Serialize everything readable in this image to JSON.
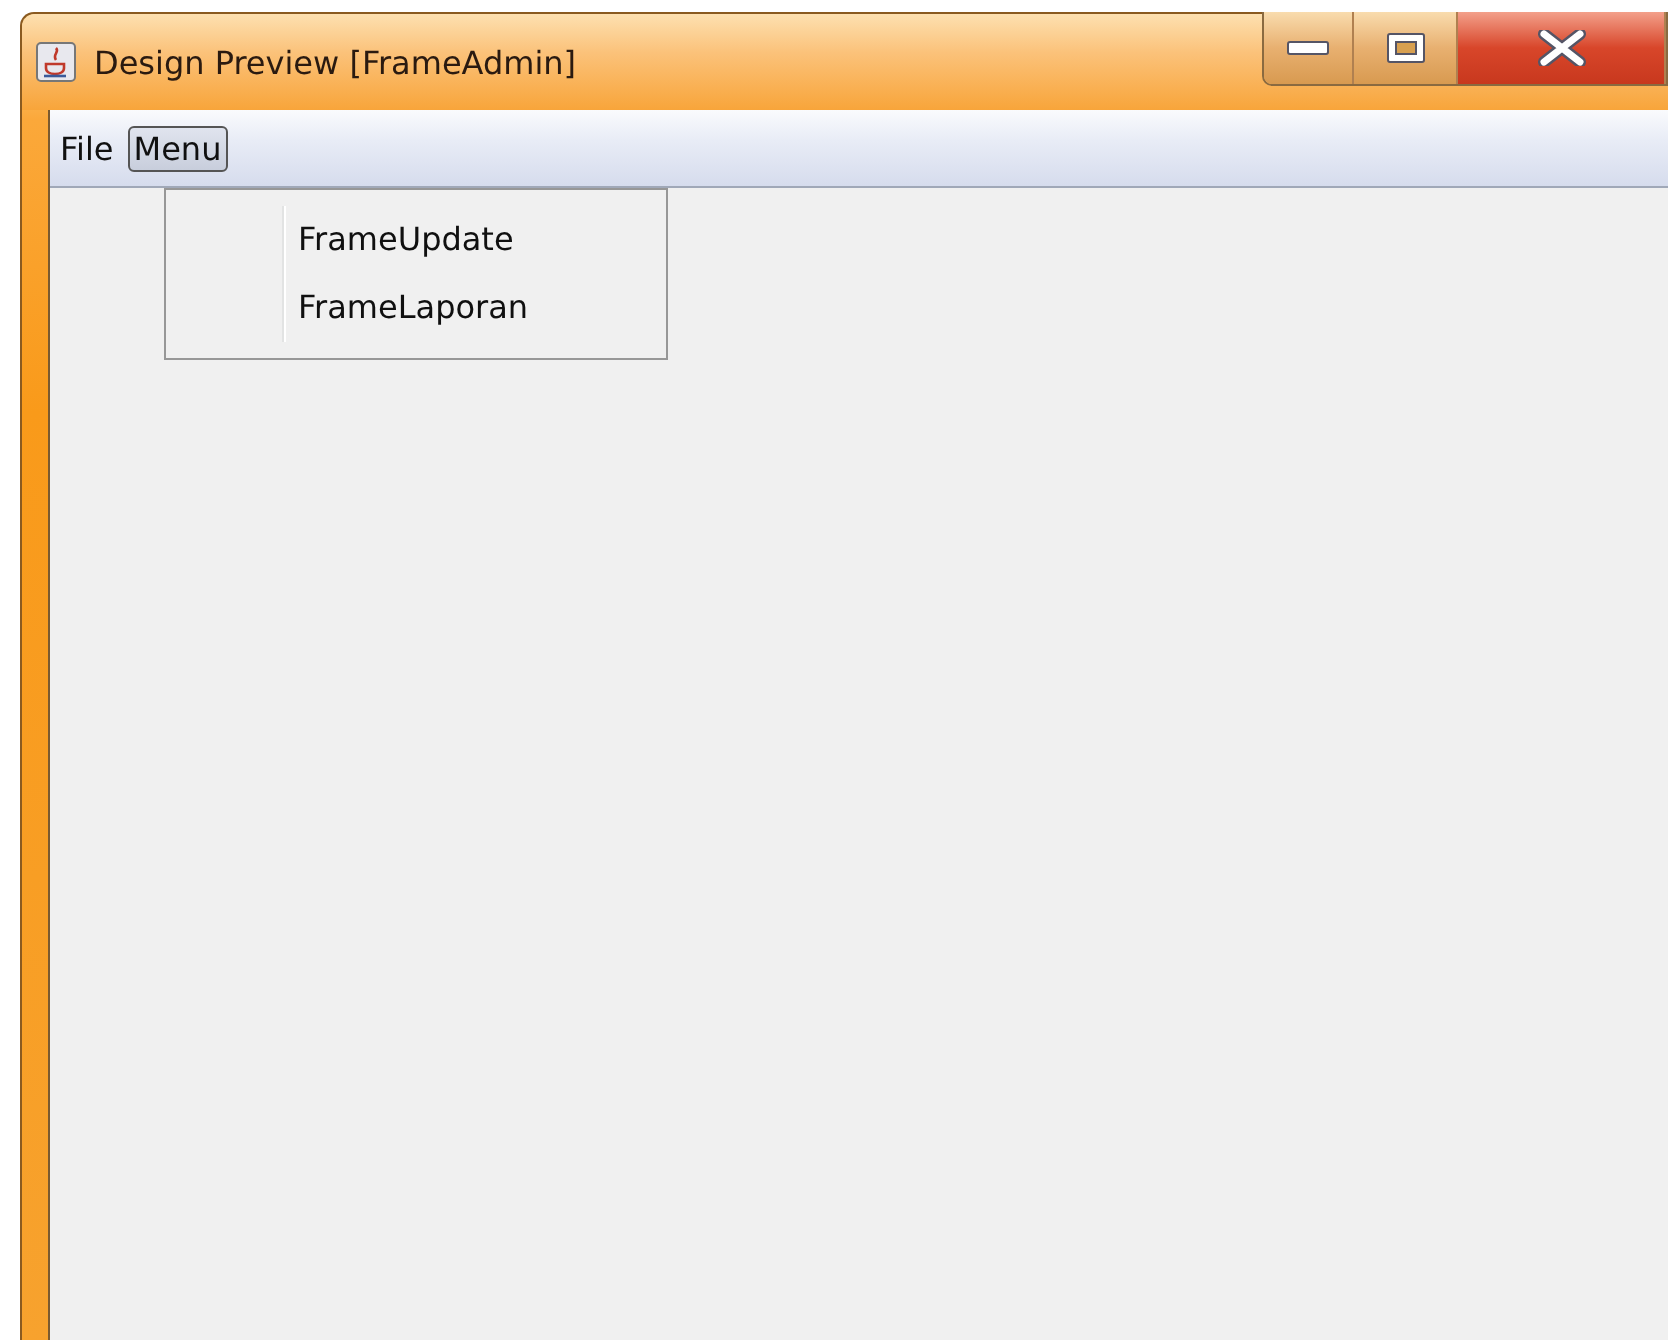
{
  "window": {
    "title": "Design Preview [FrameAdmin]"
  },
  "menu_bar": {
    "items": [
      {
        "label": "File",
        "selected": false
      },
      {
        "label": "Menu",
        "selected": true
      }
    ]
  },
  "dropdown": {
    "items": [
      {
        "label": "FrameUpdate"
      },
      {
        "label": "FrameLaporan"
      }
    ]
  }
}
